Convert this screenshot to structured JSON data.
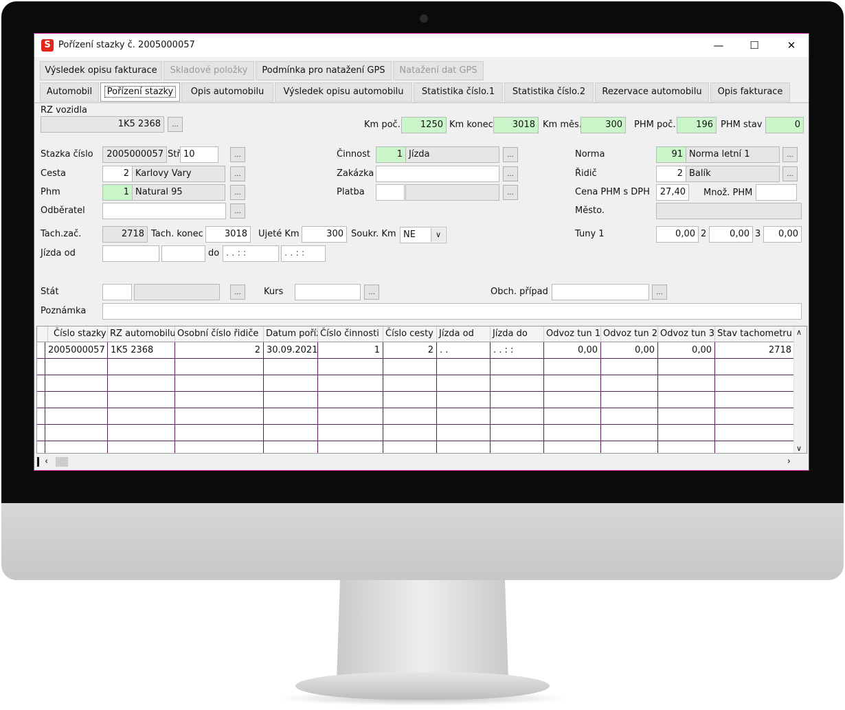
{
  "window": {
    "title": "Pořízení stazky č. 2005000057"
  },
  "tabs_top": [
    {
      "label": "Výsledek opisu fakturace",
      "disabled": false
    },
    {
      "label": "Skladové položky",
      "disabled": true
    },
    {
      "label": "Podmínka pro natažení GPS",
      "disabled": false
    },
    {
      "label": "Natažení dat GPS",
      "disabled": true
    }
  ],
  "tabs_second": [
    {
      "label": "Automobil"
    },
    {
      "label": "Pořízení stazky",
      "active": true
    },
    {
      "label": "Opis automobilu"
    },
    {
      "label": "Výsledek opisu  automobilu"
    },
    {
      "label": "Statistika číslo.1"
    },
    {
      "label": "Statistika číslo.2"
    },
    {
      "label": "Rezervace automobilu"
    },
    {
      "label": "Opis fakturace"
    }
  ],
  "header": {
    "rz_label": "RZ vozidla",
    "rz_value": "1K5 2368",
    "km_poc_label": "Km poč.",
    "km_poc": "1250",
    "km_konec_label": "Km konec",
    "km_konec": "3018",
    "km_mes_label": "Km měs.",
    "km_mes": "300",
    "phm_poc_label": "PHM poč.",
    "phm_poc": "196",
    "phm_stav_label": "PHM stav",
    "phm_stav": "0"
  },
  "form": {
    "stazka_label": "Stazka číslo",
    "stazka_value": "2005000057",
    "str_label": "Stř.",
    "str_value": "10",
    "cesta_label": "Cesta",
    "cesta_num": "2",
    "cesta_name": "Karlovy Vary",
    "phm_label": "Phm",
    "phm_num": "1",
    "phm_name": "Natural 95",
    "odberatel_label": "Odběratel",
    "cinnost_label": "Činnost",
    "cinnost_num": "1",
    "cinnost_name": "Jízda",
    "zakazka_label": "Zakázka",
    "platba_label": "Platba",
    "norma_label": "Norma",
    "norma_num": "91",
    "norma_name": "Norma letní 1",
    "ridic_label": "Řidič",
    "ridic_num": "2",
    "ridic_name": "Balík",
    "cena_label": "Cena PHM s DPH",
    "cena_value": "27,40",
    "mnoz_label": "Množ. PHM",
    "mesto_label": "Město.",
    "tach_zac_label": "Tach.zač.",
    "tach_zac": "2718",
    "tach_konec_label": "Tach. konec",
    "tach_konec": "3018",
    "ujete_label": "Ujeté Km",
    "ujete": "300",
    "soukr_label": "Soukr. Km",
    "soukr_value": "NE",
    "tuny_label": "Tuny 1",
    "tuny1": "0,00",
    "tuny2_label": "2",
    "tuny2": "0,00",
    "tuny3_label": "3",
    "tuny3": "0,00",
    "jizda_od_label": "Jízda od",
    "do_label": "do",
    "dt_mask1": ". .     : :",
    "dt_mask2": ". .     : :",
    "stat_label": "Stát",
    "kurs_label": "Kurs",
    "obch_label": "Obch. případ",
    "poznamka_label": "Poznámka",
    "dots": "..."
  },
  "grid": {
    "columns": [
      "Číslo stazky",
      "RZ automobilu",
      "Osobní číslo řidiče",
      "Datum pořízení",
      "Číslo činnosti",
      "Číslo cesty",
      "Jízda od",
      "Jízda do",
      "Odvoz tun 1",
      "Odvoz tun 2",
      "Odvoz tun 3",
      "Stav tachometru na"
    ],
    "rows": [
      [
        "2005000057",
        "1K5 2368",
        "2",
        "30.09.2021",
        "1",
        "2",
        ". .",
        ". .     : :",
        "0,00",
        "0,00",
        "0,00",
        "2718"
      ]
    ]
  }
}
